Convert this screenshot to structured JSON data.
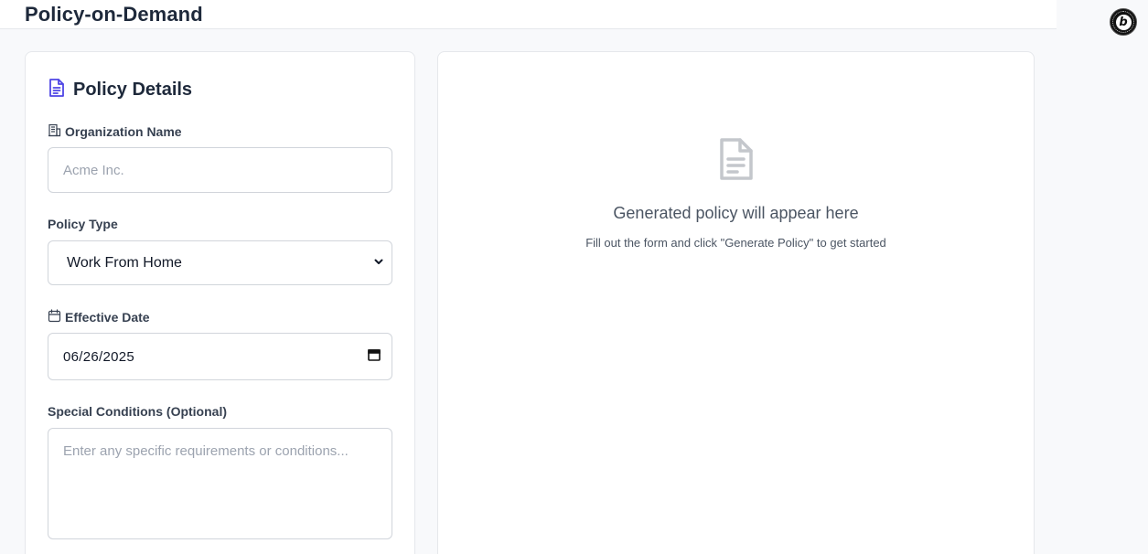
{
  "header": {
    "title": "Policy-on-Demand"
  },
  "badge": {
    "letter": "b"
  },
  "form": {
    "title": "Policy Details",
    "org_name": {
      "label": "Organization Name",
      "placeholder": "Acme Inc.",
      "value": ""
    },
    "policy_type": {
      "label": "Policy Type",
      "selected": "Work From Home"
    },
    "effective_date": {
      "label": "Effective Date",
      "value": "06/26/2025"
    },
    "special_conditions": {
      "label": "Special Conditions (Optional)",
      "placeholder": "Enter any specific requirements or conditions..."
    }
  },
  "preview": {
    "empty_title": "Generated policy will appear here",
    "empty_subtitle": "Fill out the form and click \"Generate Policy\" to get started"
  },
  "colors": {
    "accent": "#4f46e5",
    "muted_icon": "#9ca3af"
  },
  "icons": {
    "title_icon": "document-icon",
    "org_icon": "building-icon",
    "date_icon": "calendar-icon",
    "empty_icon": "document-icon"
  }
}
